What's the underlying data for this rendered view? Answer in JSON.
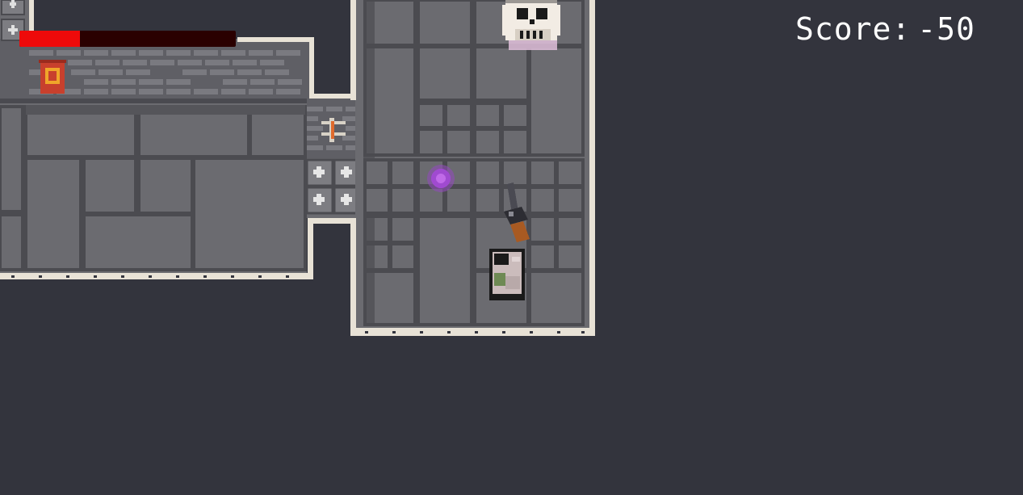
{
  "hud": {
    "score_label": "Score:",
    "score_value": "-50",
    "health_fraction": 0.28,
    "health_color": "#ee0a0a",
    "health_bg_color": "#2a0000"
  },
  "colors": {
    "background": "#33343d",
    "floor": "#6e6e73",
    "tile_line": "#4e4e53",
    "wall_face": "#5a5a60",
    "wall_edge": "#e8e2d6"
  },
  "entities": {
    "player": {
      "icon": "knight-player-icon"
    },
    "weapon": {
      "icon": "pistol-weapon-icon"
    },
    "enemy": {
      "icon": "skull-enemy-icon"
    },
    "projectile": {
      "icon": "purple-energy-orb-icon",
      "color": "#a04ad0"
    },
    "banner": {
      "icon": "wall-banner-icon"
    },
    "torch": {
      "icon": "wall-torch-icon"
    },
    "spikes": {
      "icon": "floor-spike-trap-icon"
    }
  }
}
